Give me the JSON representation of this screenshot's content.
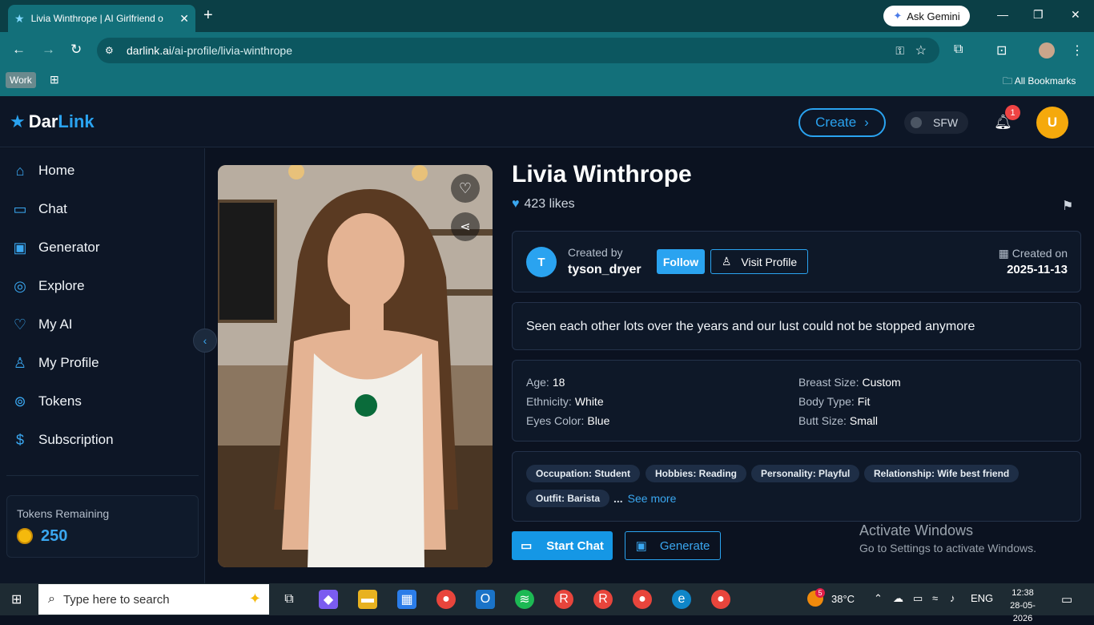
{
  "browser": {
    "tab_title": "Livia Winthrope | AI Girlfriend o",
    "ask_gemini": "Ask Gemini",
    "url_domain": "darlink.ai",
    "url_path": "/ai-profile/livia-winthrope",
    "bookmark_work": "Work",
    "all_bookmarks": "All Bookmarks"
  },
  "site": {
    "logo_dar": "Dar",
    "logo_link": "Link",
    "create_label": "Create",
    "sfw_label": "SFW",
    "notification_count": "1",
    "avatar_letter": "U"
  },
  "sidebar": {
    "items": [
      {
        "label": "Home",
        "icon": "home-icon"
      },
      {
        "label": "Chat",
        "icon": "chat-icon"
      },
      {
        "label": "Generator",
        "icon": "image-icon"
      },
      {
        "label": "Explore",
        "icon": "compass-icon"
      },
      {
        "label": "My AI",
        "icon": "heart-icon"
      },
      {
        "label": "My Profile",
        "icon": "user-icon"
      },
      {
        "label": "Tokens",
        "icon": "coins-icon"
      },
      {
        "label": "Subscription",
        "icon": "dollar-icon"
      }
    ],
    "tokens_label": "Tokens Remaining",
    "tokens_value": "250"
  },
  "profile": {
    "name": "Livia Winthrope",
    "likes": "423 likes",
    "creator_initial": "T",
    "created_by_label": "Created by",
    "creator_name": "tyson_dryer",
    "follow_label": "Follow",
    "visit_profile_label": "Visit Profile",
    "created_on_label": "Created on",
    "created_on_date": "2025-11-13",
    "description": "Seen each other lots over the years and our lust could not be stopped anymore",
    "attributes_left": [
      {
        "label": "Age:",
        "value": "18"
      },
      {
        "label": "Ethnicity:",
        "value": "White"
      },
      {
        "label": "Eyes Color:",
        "value": "Blue"
      }
    ],
    "attributes_right": [
      {
        "label": "Breast Size:",
        "value": "Custom"
      },
      {
        "label": "Body Type:",
        "value": "Fit"
      },
      {
        "label": "Butt Size:",
        "value": "Small"
      }
    ],
    "tags": [
      "Occupation: Student",
      "Hobbies: Reading",
      "Personality: Playful",
      "Relationship: Wife best friend",
      "Outfit: Barista"
    ],
    "ellipsis": "...",
    "see_more": "See more",
    "start_chat_label": "Start Chat",
    "generate_label": "Generate"
  },
  "watermark": {
    "line1": "Activate Windows",
    "line2": "Go to Settings to activate Windows."
  },
  "taskbar": {
    "search_placeholder": "Type here to search",
    "weather_badge": "5",
    "temperature": "38°C",
    "language": "ENG",
    "time": "12:38",
    "date": "28-05-2026"
  }
}
